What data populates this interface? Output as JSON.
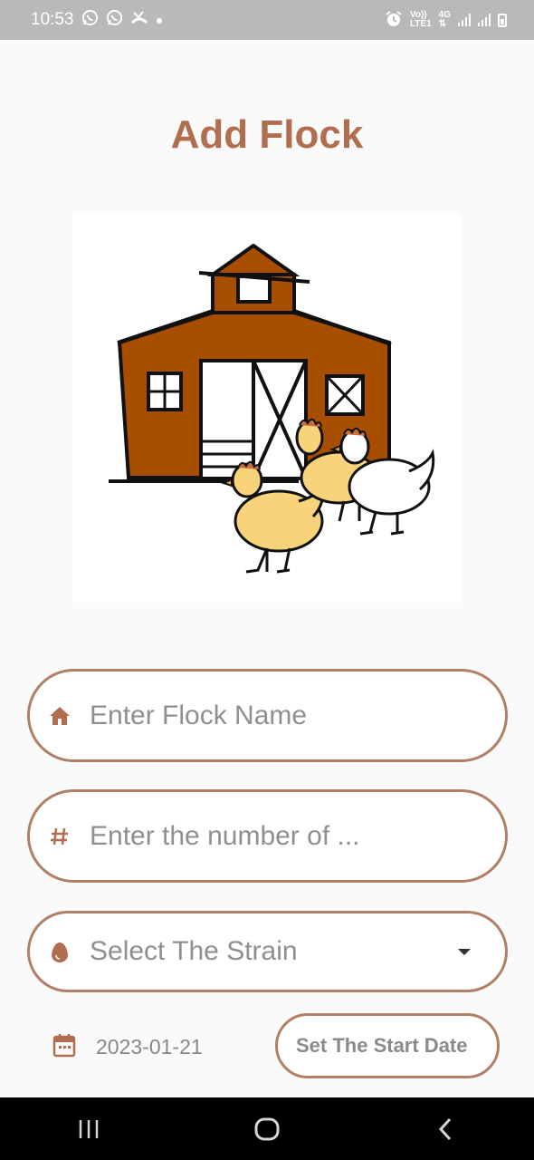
{
  "status_bar": {
    "time": "10:53",
    "left_icons": [
      "whatsapp-icon",
      "whatsapp-icon",
      "missed-call-icon",
      "dot-icon"
    ],
    "network_top": "Vo))",
    "network_bottom": "LTE1",
    "network_type": "4G",
    "right_icons": [
      "alarm-icon",
      "signal-icon",
      "signal-icon",
      "battery-icon"
    ]
  },
  "page": {
    "title": "Add Flock",
    "title_color": "#b06e4f",
    "accent_color": "#b07f66"
  },
  "illustration": {
    "icon": "barn-with-chickens-illustration"
  },
  "form": {
    "flock_name": {
      "placeholder": "Enter Flock Name",
      "value": "",
      "icon": "home-icon"
    },
    "bird_count": {
      "placeholder": "Enter the number of ...",
      "value": "",
      "icon": "hash-icon"
    },
    "strain": {
      "placeholder": "Select The Strain",
      "icon": "egg-icon"
    },
    "start_date": {
      "value": "2023-01-21",
      "icon": "calendar-icon",
      "button_label": "Set The Start Date"
    }
  },
  "nav_bar": {
    "buttons": [
      "recent-apps-icon",
      "home-icon",
      "back-icon"
    ]
  }
}
